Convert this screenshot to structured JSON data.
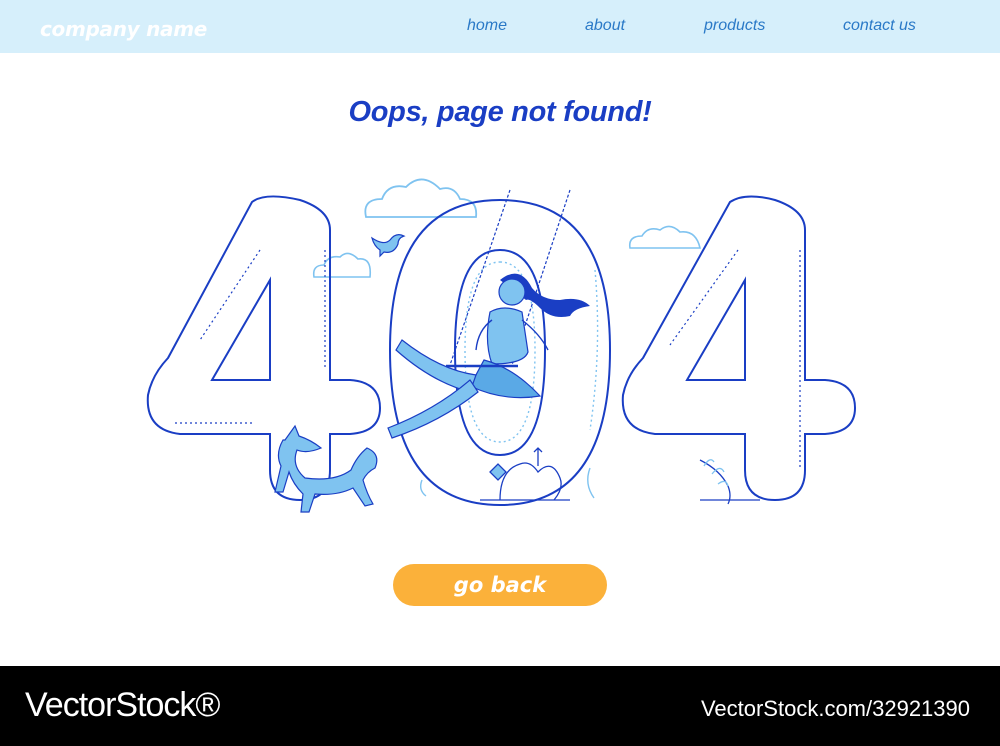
{
  "header": {
    "brand": "company name",
    "nav": {
      "home": "home",
      "about": "about",
      "products": "products",
      "contact": "contact us"
    }
  },
  "main": {
    "headline": "Oops, page not found!",
    "error_code": "404",
    "go_back_label": "go back"
  },
  "footer": {
    "brand": "VectorStock®",
    "image_id": "VectorStock.com/32921390"
  },
  "colors": {
    "header_bg": "#d6effb",
    "nav_text": "#2a79c7",
    "headline": "#1a3ec4",
    "outline": "#1a3ec4",
    "figure_fill": "#7fc3f0",
    "button": "#fbb13a",
    "footer_bg": "#000000"
  }
}
